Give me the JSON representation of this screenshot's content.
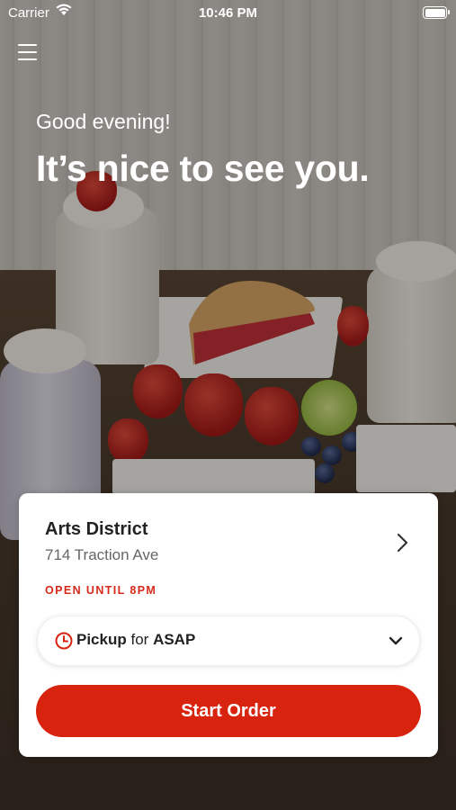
{
  "status_bar": {
    "carrier": "Carrier",
    "time": "10:46 PM"
  },
  "greeting": "Good evening!",
  "headline": "It’s nice to see you.",
  "location": {
    "name": "Arts District",
    "address": "714 Traction Ave",
    "hours": "OPEN UNTIL 8PM"
  },
  "order_mode": {
    "method": "Pickup",
    "connector": "for",
    "time": "ASAP"
  },
  "start_button": "Start Order",
  "colors": {
    "accent": "#d8230f",
    "hours_text": "#d52a1a"
  }
}
